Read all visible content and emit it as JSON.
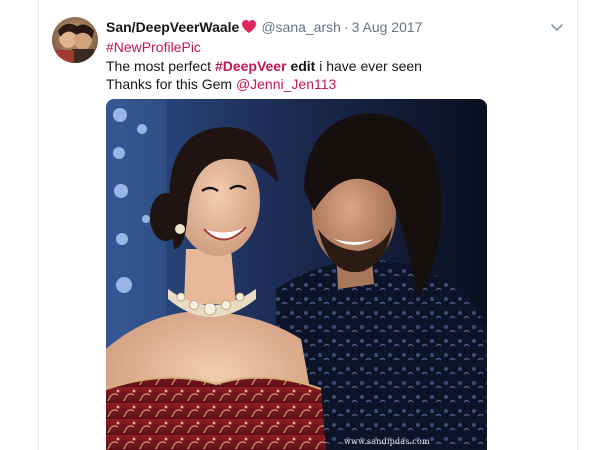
{
  "tweet": {
    "display_name": "San/DeepVeerWaale",
    "handle": "@sana_arsh",
    "separator": "·",
    "date": "3 Aug 2017",
    "hashtag_profile": "#NewProfilePic",
    "text_prefix": "The most perfect ",
    "hashtag_deepveer": "#DeepVeer",
    "text_bold": "edit",
    "text_suffix": " i have ever seen",
    "thanks_prefix": "Thanks for this Gem ",
    "mention": "@Jenni_Jen113",
    "watermark": "www.sandipdas.com"
  },
  "colors": {
    "link": "#c5174f",
    "name": "#14171a",
    "meta": "#657786",
    "heart": "#e0245e"
  },
  "icons": {
    "heart": "heart-icon",
    "caret": "chevron-down-icon"
  }
}
